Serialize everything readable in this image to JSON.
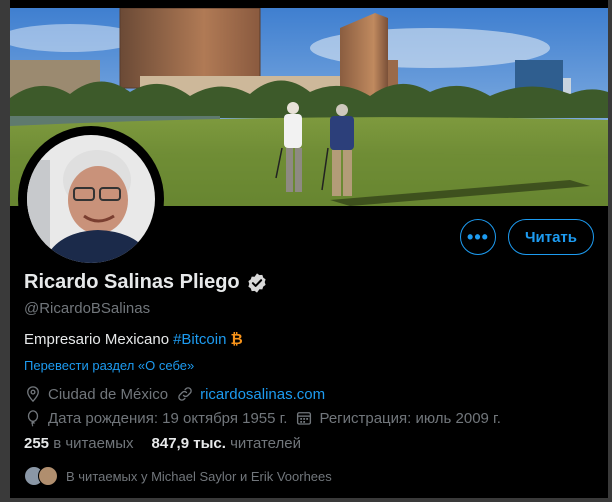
{
  "profile": {
    "name": "Ricardo Salinas Pliego",
    "handle": "@RicardoBSalinas",
    "bio_text": "Empresario Mexicano",
    "bio_hashtag": "#Bitcoin",
    "bio_symbol": "₿",
    "translate_link": "Перевести раздел «О себе»",
    "location": "Ciudad de México",
    "website": "ricardosalinas.com",
    "birth_date": "Дата рождения: 19 октября 1955 г.",
    "joined": "Регистрация: июль 2009 г.",
    "following_count": "255",
    "following_label": "в читаемых",
    "followers_count": "847,9 тыс.",
    "followers_label": "читателей",
    "known_followers": "В читаемых у Michael Saylor и Erik Voorhees"
  },
  "actions": {
    "more_label": "•••",
    "follow_label": "Читать"
  },
  "icons": {
    "verified": "verified-badge-icon",
    "location": "location-pin-icon",
    "link": "link-icon",
    "birthday": "balloon-icon",
    "calendar": "calendar-icon"
  },
  "colors": {
    "accent": "#1d9bf0",
    "background": "#000000",
    "text": "#e7e9ea",
    "secondary": "#71767b",
    "bitcoin": "#f7931a"
  }
}
